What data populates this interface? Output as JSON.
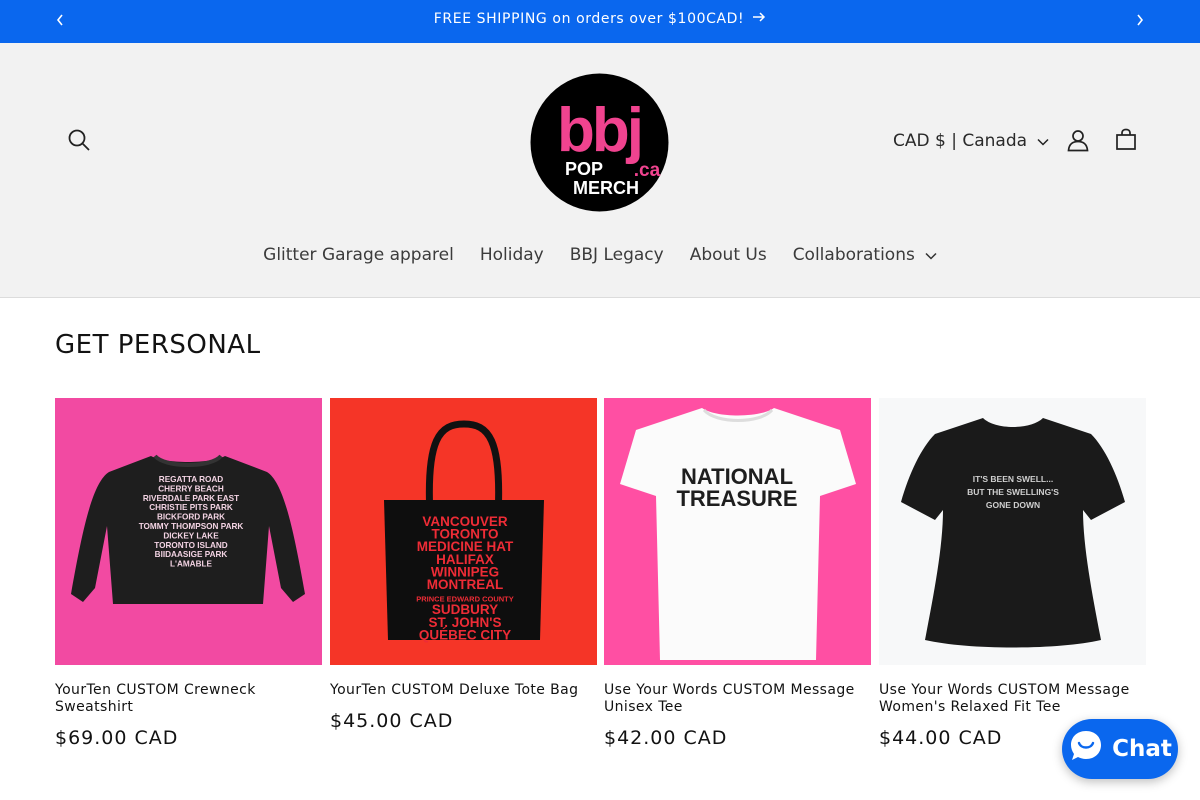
{
  "announcement": {
    "text": "FREE SHIPPING on orders over $100CAD!",
    "prev_icon": "chevron-left-icon",
    "next_icon": "chevron-right-icon"
  },
  "header": {
    "logo": {
      "main": "bbj",
      "suffix": ".ca",
      "line1": "POP",
      "line2": "MERCH"
    },
    "currency": "CAD $ | Canada",
    "icons": [
      "search-icon",
      "account-icon",
      "cart-icon"
    ]
  },
  "nav": [
    {
      "label": "Glitter Garage apparel"
    },
    {
      "label": "Holiday"
    },
    {
      "label": "BBJ Legacy"
    },
    {
      "label": "About Us"
    },
    {
      "label": "Collaborations"
    }
  ],
  "section": {
    "title": "GET PERSONAL"
  },
  "products": [
    {
      "title": "YourTen CUSTOM Crewneck Sweatshirt",
      "price": "$69.00 CAD",
      "bg": "#f24aa2",
      "print": [
        "REGATTA ROAD",
        "CHERRY BEACH",
        "RIVERDALE PARK EAST",
        "CHRISTIE PITS PARK",
        "BICKFORD PARK",
        "TOMMY THOMPSON PARK",
        "DICKEY LAKE",
        "TORONTO ISLAND",
        "BIIDAASIGE PARK",
        "L'AMABLE"
      ]
    },
    {
      "title": "YourTen CUSTOM Deluxe Tote Bag",
      "price": "$45.00 CAD",
      "bg": "#f53527",
      "print": [
        "VANCOUVER",
        "TORONTO",
        "MEDICINE HAT",
        "HALIFAX",
        "WINNIPEG",
        "MONTREAL",
        "PRINCE EDWARD COUNTY",
        "SUDBURY",
        "ST. JOHN'S",
        "QUÉBEC CITY"
      ]
    },
    {
      "title": "Use Your Words CUSTOM Message Unisex Tee",
      "price": "$42.00 CAD",
      "bg": "#ff4fa3",
      "print": [
        "NATIONAL",
        "TREASURE"
      ]
    },
    {
      "title": "Use Your Words CUSTOM Message Women's Relaxed Fit Tee",
      "price": "$44.00 CAD",
      "bg": "#f7f8f9",
      "print": [
        "IT'S BEEN SWELL...",
        "BUT THE SWELLING'S",
        "GONE DOWN"
      ]
    }
  ],
  "chat": {
    "label": "Chat",
    "icon": "chat-bubble-icon"
  },
  "colors": {
    "brand_blue": "#0a67ee",
    "logo_pink": "#f0438f",
    "header_bg": "#f2f2f2"
  }
}
